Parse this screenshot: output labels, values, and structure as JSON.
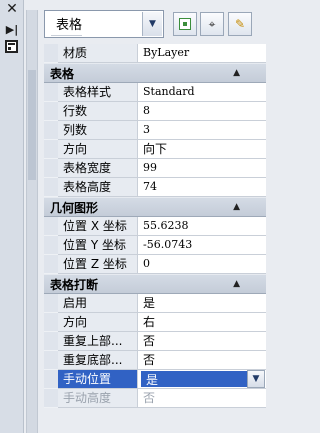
{
  "toolbar": {
    "object_type": "表格"
  },
  "top_rows": [
    {
      "label": "材质",
      "value": "ByLayer"
    }
  ],
  "sections": {
    "table": {
      "title": "表格",
      "rows": [
        {
          "label": "表格样式",
          "value": "Standard"
        },
        {
          "label": "行数",
          "value": "8"
        },
        {
          "label": "列数",
          "value": "3"
        },
        {
          "label": "方向",
          "value": "向下"
        },
        {
          "label": "表格宽度",
          "value": "99"
        },
        {
          "label": "表格高度",
          "value": "74"
        }
      ]
    },
    "geometry": {
      "title": "几何图形",
      "rows": [
        {
          "label": "位置 X 坐标",
          "value": "55.6238"
        },
        {
          "label": "位置 Y 坐标",
          "value": "-56.0743"
        },
        {
          "label": "位置 Z 坐标",
          "value": "0"
        }
      ]
    },
    "table_break": {
      "title": "表格打断",
      "rows": [
        {
          "label": "启用",
          "value": "是"
        },
        {
          "label": "方向",
          "value": "右"
        },
        {
          "label": "重复上部...",
          "value": "否"
        },
        {
          "label": "重复底部...",
          "value": "否"
        },
        {
          "label": "手动位置",
          "value": "是"
        },
        {
          "label": "手动高度",
          "value": "否"
        }
      ]
    }
  },
  "icons": {
    "close": "close-icon",
    "collapse": "auto-hide-icon",
    "properties": "properties-icon",
    "quick_select": "quick-select-icon",
    "select_objects": "select-objects-icon",
    "toggle_pickadd": "toggle-pickadd-icon"
  }
}
